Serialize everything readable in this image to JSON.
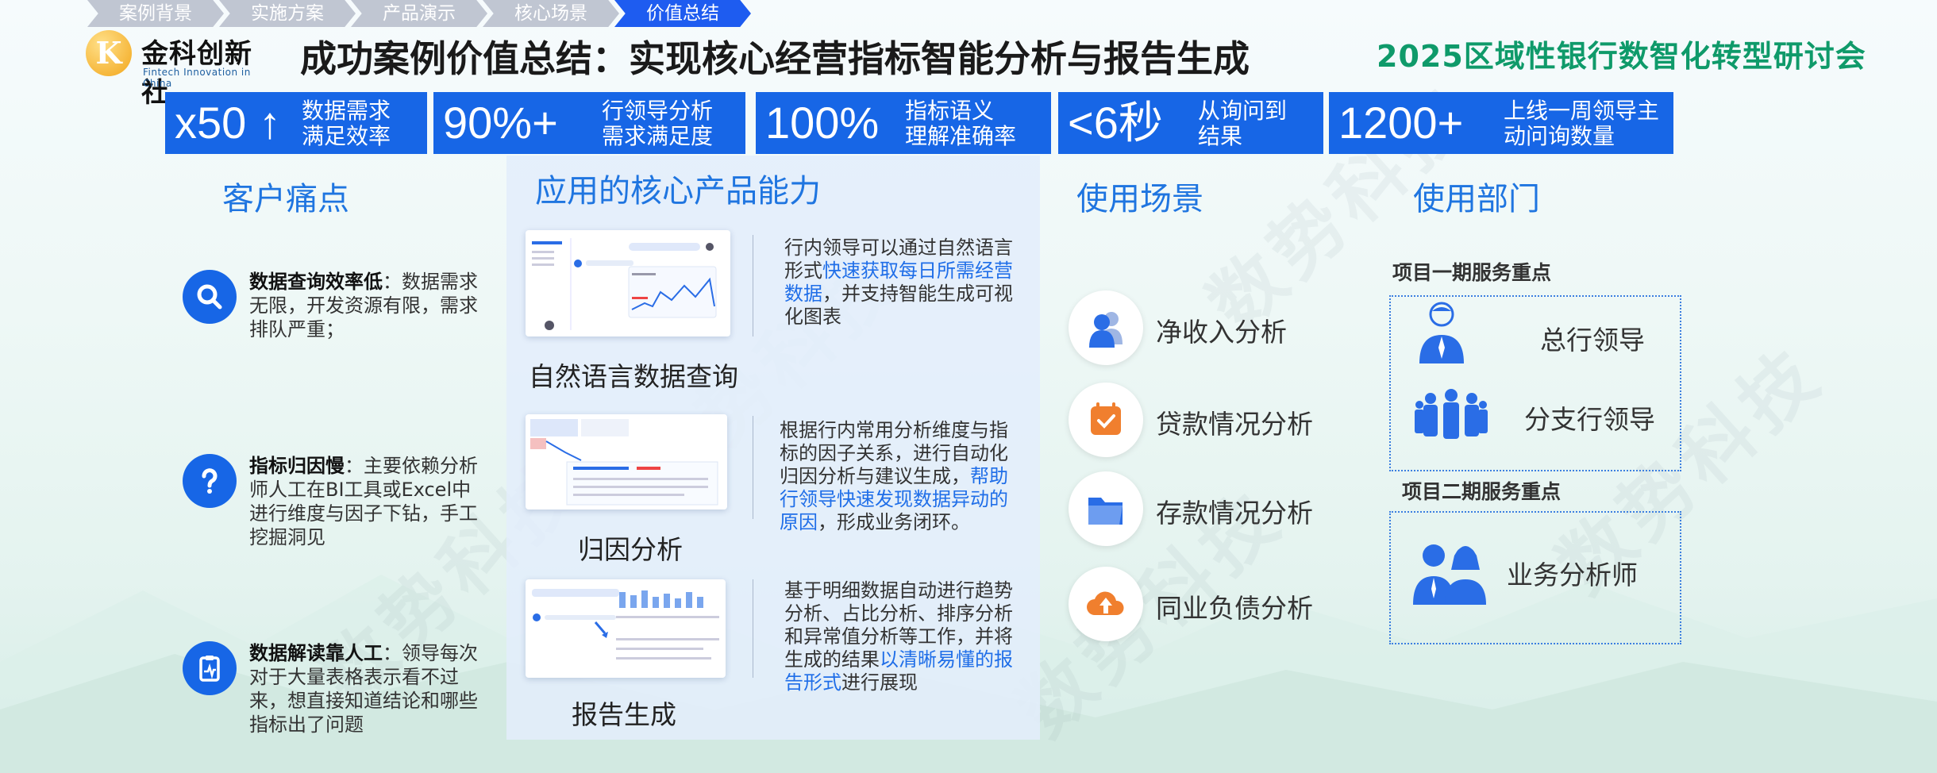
{
  "nav": [
    "案例背景",
    "实施方案",
    "产品演示",
    "核心场景",
    "价值总结"
  ],
  "nav_active_index": 4,
  "logo": {
    "name": "金科创新社",
    "sub": "Fintech Innovation in China",
    "mark": "K"
  },
  "title": "成功案例价值总结：实现核心经营指标智能分析与报告生成",
  "event": "2025区域性银行数智化转型研讨会",
  "stats": [
    {
      "value": "x50 ↑",
      "label1": "数据需求",
      "label2": "满足效率"
    },
    {
      "value": "90%+",
      "label1": "行领导分析",
      "label2": "需求满足度"
    },
    {
      "value": "100%",
      "label1": "指标语义",
      "label2": "理解准确率"
    },
    {
      "value": "<6秒",
      "label1": "从询问到",
      "label2": "结果"
    },
    {
      "value": "1200+",
      "label1": "上线一周领导主",
      "label2": "动问询数量"
    }
  ],
  "pain": {
    "heading": "客户痛点",
    "items": [
      {
        "icon": "search-icon",
        "title": "数据查询效率低",
        "text": "：数据需求无限，开发资源有限，需求排队严重；"
      },
      {
        "icon": "question-icon",
        "title": "指标归因慢",
        "text": "：主要依赖分析师人工在BI工具或Excel中进行维度与因子下钻，手工挖掘洞见"
      },
      {
        "icon": "clipboard-icon",
        "title": "数据解读靠人工",
        "text": "：领导每次对于大量表格表示看不过来，想直接知道结论和哪些指标出了问题"
      }
    ]
  },
  "core": {
    "heading": "应用的核心产品能力",
    "items": [
      {
        "title": "自然语言数据查询",
        "desc_a": "行内领导可以通过自然语言形式",
        "desc_hl": "快速获取每日所需经营数据",
        "desc_b": "，并支持智能生成可视化图表"
      },
      {
        "title": "归因分析",
        "desc_a": "根据行内常用分析维度与指标的因子关系，进行自动化归因分析与建议生成，",
        "desc_hl": "帮助行领导快速发现数据异动的原因",
        "desc_b": "，形成业务闭环。"
      },
      {
        "title": "报告生成",
        "desc_a": "基于明细数据自动进行趋势分析、占比分析、排序分析和异常值分析等工作，并将生成的结果",
        "desc_hl": "以清晰易懂的报告形式",
        "desc_b": "进行展现"
      }
    ]
  },
  "scenes": {
    "heading": "使用场景",
    "items": [
      {
        "icon": "users-icon",
        "label": "净收入分析"
      },
      {
        "icon": "calendar-check-icon",
        "label": "贷款情况分析"
      },
      {
        "icon": "folder-icon",
        "label": "存款情况分析"
      },
      {
        "icon": "cloud-upload-icon",
        "label": "同业负债分析"
      }
    ]
  },
  "depts": {
    "heading": "使用部门",
    "phase1": "项目一期服务重点",
    "phase1_items": [
      "总行领导",
      "分支行领导"
    ],
    "phase2": "项目二期服务重点",
    "phase2_items": [
      "业务分析师"
    ]
  },
  "watermark": "数势科技",
  "colors": {
    "brand_blue": "#1766e6",
    "heading_blue": "#1f75e0",
    "event_green": "#0f9a6a",
    "highlight": "#1f6ee8"
  }
}
